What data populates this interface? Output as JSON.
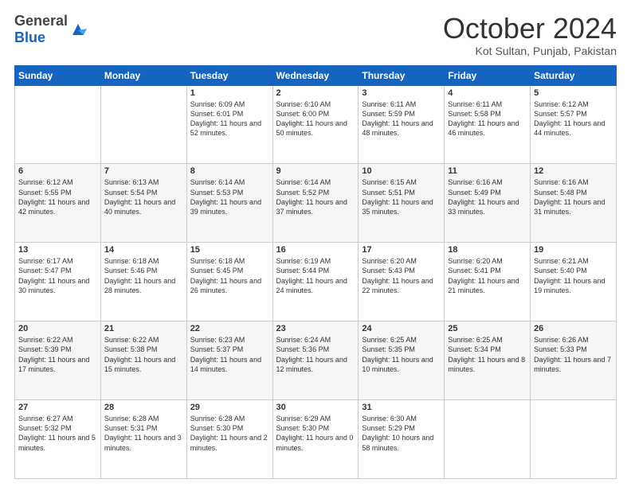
{
  "header": {
    "logo_general": "General",
    "logo_blue": "Blue",
    "month_title": "October 2024",
    "location": "Kot Sultan, Punjab, Pakistan"
  },
  "days_of_week": [
    "Sunday",
    "Monday",
    "Tuesday",
    "Wednesday",
    "Thursday",
    "Friday",
    "Saturday"
  ],
  "weeks": [
    [
      {
        "day": "",
        "sunrise": "",
        "sunset": "",
        "daylight": ""
      },
      {
        "day": "",
        "sunrise": "",
        "sunset": "",
        "daylight": ""
      },
      {
        "day": "1",
        "sunrise": "Sunrise: 6:09 AM",
        "sunset": "Sunset: 6:01 PM",
        "daylight": "Daylight: 11 hours and 52 minutes."
      },
      {
        "day": "2",
        "sunrise": "Sunrise: 6:10 AM",
        "sunset": "Sunset: 6:00 PM",
        "daylight": "Daylight: 11 hours and 50 minutes."
      },
      {
        "day": "3",
        "sunrise": "Sunrise: 6:11 AM",
        "sunset": "Sunset: 5:59 PM",
        "daylight": "Daylight: 11 hours and 48 minutes."
      },
      {
        "day": "4",
        "sunrise": "Sunrise: 6:11 AM",
        "sunset": "Sunset: 5:58 PM",
        "daylight": "Daylight: 11 hours and 46 minutes."
      },
      {
        "day": "5",
        "sunrise": "Sunrise: 6:12 AM",
        "sunset": "Sunset: 5:57 PM",
        "daylight": "Daylight: 11 hours and 44 minutes."
      }
    ],
    [
      {
        "day": "6",
        "sunrise": "Sunrise: 6:12 AM",
        "sunset": "Sunset: 5:55 PM",
        "daylight": "Daylight: 11 hours and 42 minutes."
      },
      {
        "day": "7",
        "sunrise": "Sunrise: 6:13 AM",
        "sunset": "Sunset: 5:54 PM",
        "daylight": "Daylight: 11 hours and 40 minutes."
      },
      {
        "day": "8",
        "sunrise": "Sunrise: 6:14 AM",
        "sunset": "Sunset: 5:53 PM",
        "daylight": "Daylight: 11 hours and 39 minutes."
      },
      {
        "day": "9",
        "sunrise": "Sunrise: 6:14 AM",
        "sunset": "Sunset: 5:52 PM",
        "daylight": "Daylight: 11 hours and 37 minutes."
      },
      {
        "day": "10",
        "sunrise": "Sunrise: 6:15 AM",
        "sunset": "Sunset: 5:51 PM",
        "daylight": "Daylight: 11 hours and 35 minutes."
      },
      {
        "day": "11",
        "sunrise": "Sunrise: 6:16 AM",
        "sunset": "Sunset: 5:49 PM",
        "daylight": "Daylight: 11 hours and 33 minutes."
      },
      {
        "day": "12",
        "sunrise": "Sunrise: 6:16 AM",
        "sunset": "Sunset: 5:48 PM",
        "daylight": "Daylight: 11 hours and 31 minutes."
      }
    ],
    [
      {
        "day": "13",
        "sunrise": "Sunrise: 6:17 AM",
        "sunset": "Sunset: 5:47 PM",
        "daylight": "Daylight: 11 hours and 30 minutes."
      },
      {
        "day": "14",
        "sunrise": "Sunrise: 6:18 AM",
        "sunset": "Sunset: 5:46 PM",
        "daylight": "Daylight: 11 hours and 28 minutes."
      },
      {
        "day": "15",
        "sunrise": "Sunrise: 6:18 AM",
        "sunset": "Sunset: 5:45 PM",
        "daylight": "Daylight: 11 hours and 26 minutes."
      },
      {
        "day": "16",
        "sunrise": "Sunrise: 6:19 AM",
        "sunset": "Sunset: 5:44 PM",
        "daylight": "Daylight: 11 hours and 24 minutes."
      },
      {
        "day": "17",
        "sunrise": "Sunrise: 6:20 AM",
        "sunset": "Sunset: 5:43 PM",
        "daylight": "Daylight: 11 hours and 22 minutes."
      },
      {
        "day": "18",
        "sunrise": "Sunrise: 6:20 AM",
        "sunset": "Sunset: 5:41 PM",
        "daylight": "Daylight: 11 hours and 21 minutes."
      },
      {
        "day": "19",
        "sunrise": "Sunrise: 6:21 AM",
        "sunset": "Sunset: 5:40 PM",
        "daylight": "Daylight: 11 hours and 19 minutes."
      }
    ],
    [
      {
        "day": "20",
        "sunrise": "Sunrise: 6:22 AM",
        "sunset": "Sunset: 5:39 PM",
        "daylight": "Daylight: 11 hours and 17 minutes."
      },
      {
        "day": "21",
        "sunrise": "Sunrise: 6:22 AM",
        "sunset": "Sunset: 5:38 PM",
        "daylight": "Daylight: 11 hours and 15 minutes."
      },
      {
        "day": "22",
        "sunrise": "Sunrise: 6:23 AM",
        "sunset": "Sunset: 5:37 PM",
        "daylight": "Daylight: 11 hours and 14 minutes."
      },
      {
        "day": "23",
        "sunrise": "Sunrise: 6:24 AM",
        "sunset": "Sunset: 5:36 PM",
        "daylight": "Daylight: 11 hours and 12 minutes."
      },
      {
        "day": "24",
        "sunrise": "Sunrise: 6:25 AM",
        "sunset": "Sunset: 5:35 PM",
        "daylight": "Daylight: 11 hours and 10 minutes."
      },
      {
        "day": "25",
        "sunrise": "Sunrise: 6:25 AM",
        "sunset": "Sunset: 5:34 PM",
        "daylight": "Daylight: 11 hours and 8 minutes."
      },
      {
        "day": "26",
        "sunrise": "Sunrise: 6:26 AM",
        "sunset": "Sunset: 5:33 PM",
        "daylight": "Daylight: 11 hours and 7 minutes."
      }
    ],
    [
      {
        "day": "27",
        "sunrise": "Sunrise: 6:27 AM",
        "sunset": "Sunset: 5:32 PM",
        "daylight": "Daylight: 11 hours and 5 minutes."
      },
      {
        "day": "28",
        "sunrise": "Sunrise: 6:28 AM",
        "sunset": "Sunset: 5:31 PM",
        "daylight": "Daylight: 11 hours and 3 minutes."
      },
      {
        "day": "29",
        "sunrise": "Sunrise: 6:28 AM",
        "sunset": "Sunset: 5:30 PM",
        "daylight": "Daylight: 11 hours and 2 minutes."
      },
      {
        "day": "30",
        "sunrise": "Sunrise: 6:29 AM",
        "sunset": "Sunset: 5:30 PM",
        "daylight": "Daylight: 11 hours and 0 minutes."
      },
      {
        "day": "31",
        "sunrise": "Sunrise: 6:30 AM",
        "sunset": "Sunset: 5:29 PM",
        "daylight": "Daylight: 10 hours and 58 minutes."
      },
      {
        "day": "",
        "sunrise": "",
        "sunset": "",
        "daylight": ""
      },
      {
        "day": "",
        "sunrise": "",
        "sunset": "",
        "daylight": ""
      }
    ]
  ]
}
